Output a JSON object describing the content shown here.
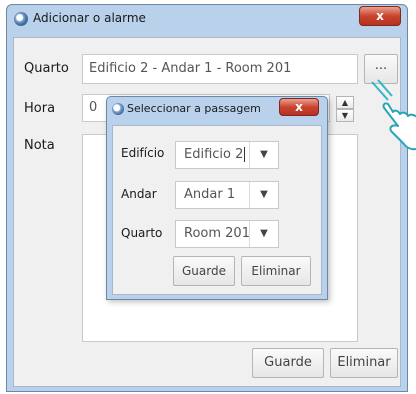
{
  "window": {
    "title": "Adicionar o alarme",
    "close_label": "x"
  },
  "main": {
    "room_label": "Quarto",
    "room_value": "Edificio 2 - Andar 1 - Room 201",
    "browse_label": "...",
    "time_label": "Hora",
    "time_value": "0",
    "note_label": "Nota",
    "save_label": "Guarde",
    "delete_label": "Eliminar"
  },
  "dialog": {
    "title": "Seleccionar a passagem",
    "close_label": "x",
    "building_label": "Edifício",
    "building_value": "Edificio 2",
    "floor_label": "Andar",
    "floor_value": "Andar 1",
    "room_label": "Quarto",
    "room_value": "Room 201",
    "save_label": "Guarde",
    "delete_label": "Eliminar"
  },
  "icons": {
    "app": "bticino-app-icon",
    "pointer": "hand-pointer-icon",
    "dropdown": "dropdown-arrow-icon"
  },
  "colors": {
    "title_bar": "#b9d1ea",
    "close_button": "#c9442f",
    "client": "#f0f0f0"
  }
}
